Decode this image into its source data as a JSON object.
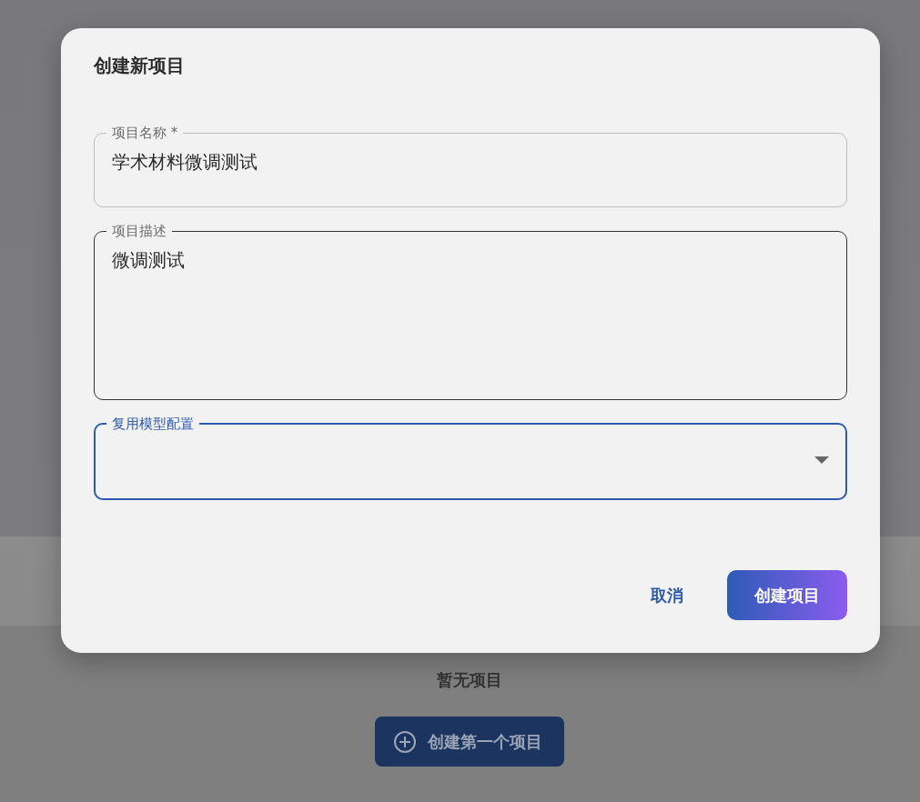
{
  "page": {
    "empty_text": "暂无项目",
    "create_first_button": "创建第一个项目"
  },
  "dialog": {
    "title": "创建新项目",
    "fields": [
      {
        "kind": "text",
        "label": "项目名称 *",
        "value": "学术材料微调测试",
        "focused": false,
        "hovered": false
      },
      {
        "kind": "textarea",
        "label": "项目描述",
        "value": "微调测试",
        "focused": false,
        "hovered": true
      },
      {
        "kind": "select",
        "label": "复用模型配置",
        "focused": true,
        "hovered": false
      }
    ],
    "cancel_button": "取消",
    "submit_button": "创建项目"
  }
}
